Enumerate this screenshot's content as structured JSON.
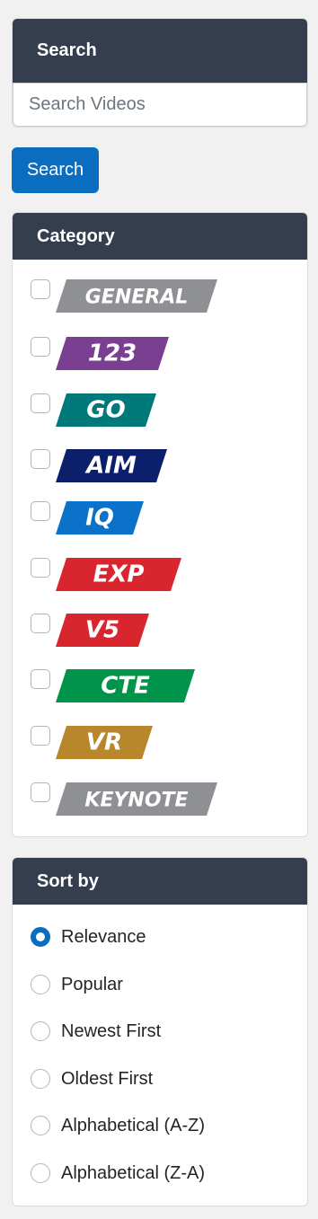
{
  "search": {
    "title": "Search",
    "placeholder": "Search Videos",
    "button_label": "Search"
  },
  "category": {
    "title": "Category",
    "items": [
      {
        "label": "GENERAL",
        "color": "#8e9093"
      },
      {
        "label": "123",
        "color": "#7b3f91"
      },
      {
        "label": "GO",
        "color": "#00797b"
      },
      {
        "label": "AIM",
        "color": "#0b1f6b"
      },
      {
        "label": "IQ",
        "color": "#0a72c9"
      },
      {
        "label": "EXP",
        "color": "#d9262e"
      },
      {
        "label": "V5",
        "color": "#d9262e"
      },
      {
        "label": "CTE",
        "color": "#00944a"
      },
      {
        "label": "VR",
        "color": "#b8862b"
      },
      {
        "label": "KEYNOTE",
        "color": "#8e9093"
      }
    ]
  },
  "sort": {
    "title": "Sort by",
    "options": [
      {
        "label": "Relevance",
        "checked": true
      },
      {
        "label": "Popular",
        "checked": false
      },
      {
        "label": "Newest First",
        "checked": false
      },
      {
        "label": "Oldest First",
        "checked": false
      },
      {
        "label": "Alphabetical (A-Z)",
        "checked": false
      },
      {
        "label": "Alphabetical (Z-A)",
        "checked": false
      }
    ]
  },
  "colors": {
    "header_bg": "#343e4f",
    "accent": "#0a6dc0",
    "page_bg": "#f1f1f1"
  }
}
